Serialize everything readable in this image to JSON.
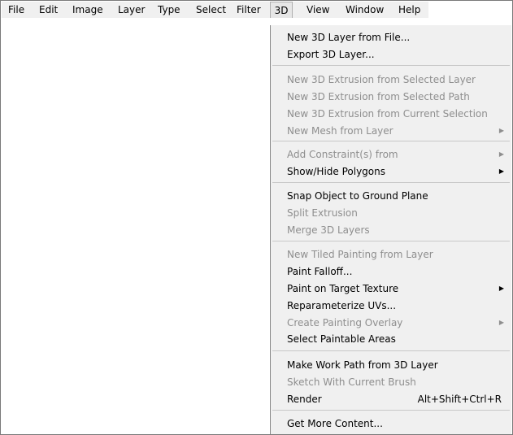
{
  "menubar": {
    "items": [
      {
        "label": "File"
      },
      {
        "label": "Edit"
      },
      {
        "label": "Image"
      },
      {
        "label": "Layer"
      },
      {
        "label": "Type"
      },
      {
        "label": "Select"
      },
      {
        "label": "Filter"
      },
      {
        "label": "3D"
      },
      {
        "label": "View"
      },
      {
        "label": "Window"
      },
      {
        "label": "Help"
      }
    ]
  },
  "menu_3d": {
    "items": [
      {
        "label": "New 3D Layer from File..."
      },
      {
        "label": "Export 3D Layer..."
      },
      {
        "label": "New 3D Extrusion from Selected Layer"
      },
      {
        "label": "New 3D Extrusion from Selected Path"
      },
      {
        "label": "New 3D Extrusion from Current Selection"
      },
      {
        "label": "New Mesh from Layer"
      },
      {
        "label": "Add Constraint(s) from"
      },
      {
        "label": "Show/Hide Polygons"
      },
      {
        "label": "Snap Object to Ground Plane"
      },
      {
        "label": "Split Extrusion"
      },
      {
        "label": "Merge 3D Layers"
      },
      {
        "label": "New Tiled Painting from Layer"
      },
      {
        "label": "Paint Falloff..."
      },
      {
        "label": "Paint on Target Texture"
      },
      {
        "label": "Reparameterize UVs..."
      },
      {
        "label": "Create Painting Overlay"
      },
      {
        "label": "Select Paintable Areas"
      },
      {
        "label": "Make Work Path from 3D Layer"
      },
      {
        "label": "Sketch With Current Brush"
      },
      {
        "label": "Render",
        "shortcut": "Alt+Shift+Ctrl+R"
      },
      {
        "label": "Get More Content..."
      }
    ],
    "submenu_arrow": "▶"
  },
  "colors": {
    "menu_bg": "#f0f0f0",
    "disabled_text": "#8e8e8e",
    "separator": "#c8c8c8"
  }
}
